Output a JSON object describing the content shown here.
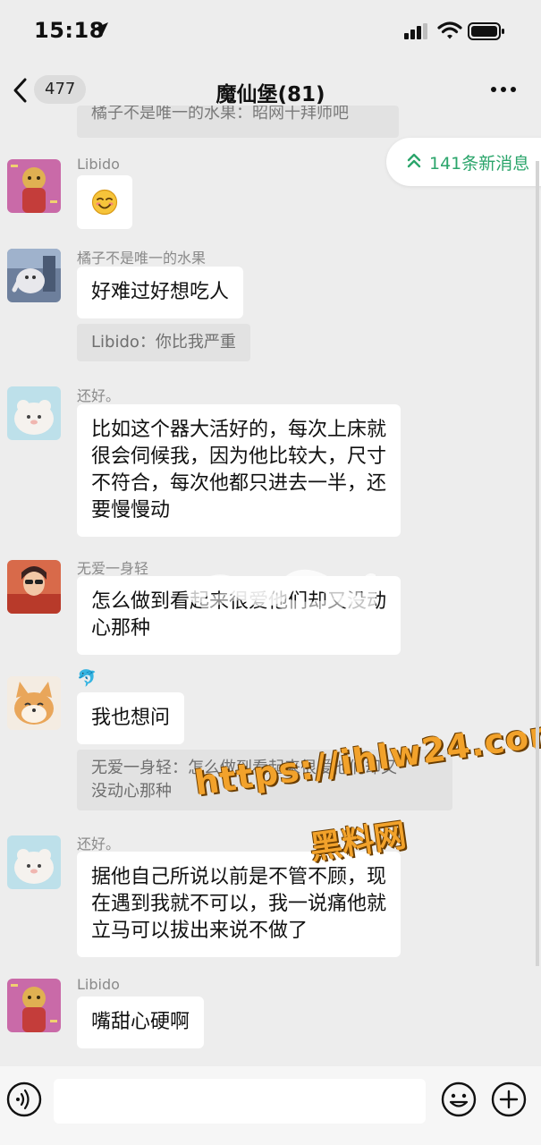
{
  "status_bar": {
    "time": "15:18"
  },
  "header": {
    "back_count": "477",
    "title": "魔仙堡(81)"
  },
  "cut_message": "橘子不是唯一的水果：昭网十拜师吧",
  "new_messages": "141条新消息",
  "messages": [
    {
      "sender": "Libido",
      "type": "emoji",
      "icon": "smiling-face-emoji"
    },
    {
      "sender": "橘子不是唯一的水果",
      "text": "好难过好想吃人",
      "quote": "Libido：你比我严重"
    },
    {
      "sender": "还好。",
      "lines": [
        "比如这个器大活好的，每次上床就",
        "很会伺候我，因为他比较大，尺寸",
        "不符合，每次他都只进去一半，还",
        "要慢慢动"
      ]
    },
    {
      "sender": "无爱一身轻",
      "lines": [
        "怎么做到看起来很爱他们却又没动",
        "心那种"
      ]
    },
    {
      "sender": "🐬",
      "text": "我也想问",
      "quote_lines": [
        "无爱一身轻：怎么做到看起来很爱他们却又",
        "没动心那种"
      ]
    },
    {
      "sender": "还好。",
      "lines": [
        "据他自己所说以前是不管不顾，现",
        "在遇到我就不可以，我一说痛他就",
        "立马可以拔出来说不做了"
      ]
    },
    {
      "sender": "Libido",
      "text": "嘴甜心硬啊"
    }
  ],
  "watermark": {
    "url": "https://ihlw24.com",
    "label": "黑料网"
  },
  "input": {
    "value": ""
  },
  "colors": {
    "background": "#ededed",
    "accent": "#2ba56b",
    "bubble": "#ffffff",
    "quote": "#e2e2e2"
  }
}
